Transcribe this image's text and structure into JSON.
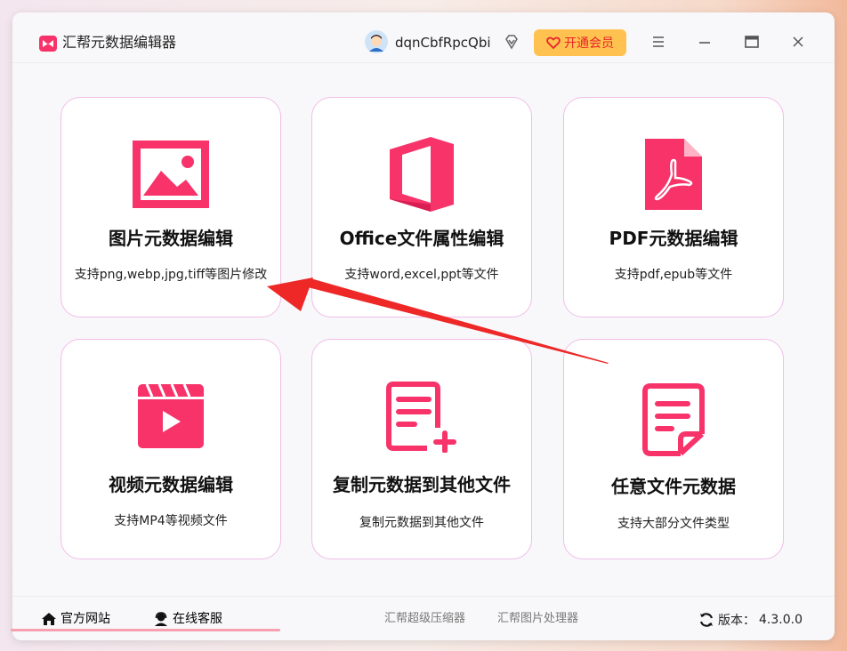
{
  "app": {
    "title": "汇帮元数据编辑器",
    "username": "dqnCbfRpcQbi",
    "vip_label": "开通会员"
  },
  "cards": [
    {
      "title": "图片元数据编辑",
      "desc": "支持png,webp,jpg,tiff等图片修改",
      "icon": "image-icon"
    },
    {
      "title": "Office文件属性编辑",
      "desc": "支持word,excel,ppt等文件",
      "icon": "office-icon"
    },
    {
      "title": "PDF元数据编辑",
      "desc": "支持pdf,epub等文件",
      "icon": "pdf-icon"
    },
    {
      "title": "视频元数据编辑",
      "desc": "支持MP4等视频文件",
      "icon": "video-icon"
    },
    {
      "title": "复制元数据到其他文件",
      "desc": "复制元数据到其他文件",
      "icon": "copy-document-icon"
    },
    {
      "title": "任意文件元数据",
      "desc": "支持大部分文件类型",
      "icon": "file-icon"
    }
  ],
  "footer": {
    "website": "官方网站",
    "support": "在线客服",
    "link1": "汇帮超级压缩器",
    "link2": "汇帮图片处理器",
    "version_label": "版本：",
    "version": "4.3.0.0"
  },
  "colors": {
    "accent": "#f7336a",
    "card_border": "#f1bde9",
    "vip_bg": "#ffc250",
    "arrow": "#ee2727"
  }
}
